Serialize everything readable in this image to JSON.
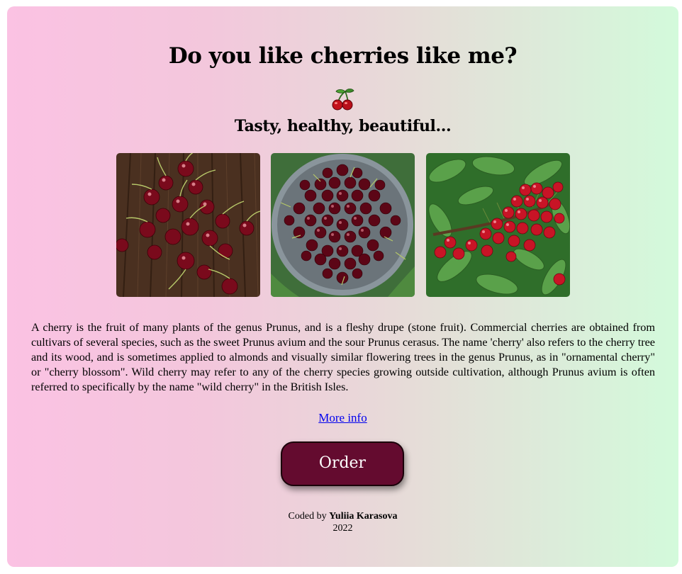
{
  "page": {
    "title": "Do you like cherries like me?",
    "emoji_icon": "cherries-icon",
    "subtitle": "Tasty, healthy, beautiful...",
    "photos": [
      {
        "name": "cherries-on-wooden-table",
        "icon": "photo-image"
      },
      {
        "name": "cherries-in-bowl",
        "icon": "photo-image"
      },
      {
        "name": "cherries-on-tree",
        "icon": "photo-image"
      }
    ],
    "description": "A cherry is the fruit of many plants of the genus Prunus, and is a fleshy drupe (stone fruit). Commercial cherries are obtained from cultivars of several species, such as the sweet Prunus avium and the sour Prunus cerasus. The name 'cherry' also refers to the cherry tree and its wood, and is sometimes applied to almonds and visually similar flowering trees in the genus Prunus, as in \"ornamental cherry\" or \"cherry blossom\". Wild cherry may refer to any of the cherry species growing outside cultivation, although Prunus avium is often referred to specifically by the name \"wild cherry\" in the British Isles.",
    "more_info_label": "More info",
    "order_label": "Order",
    "footer": {
      "prefix": "Coded by",
      "author": "Yuliia Karasova",
      "year": "2022"
    }
  },
  "colors": {
    "gradient_start": "#fbc2e3",
    "gradient_end": "#d3fadb",
    "button_bg": "#640b2f",
    "link": "#0000ee"
  }
}
